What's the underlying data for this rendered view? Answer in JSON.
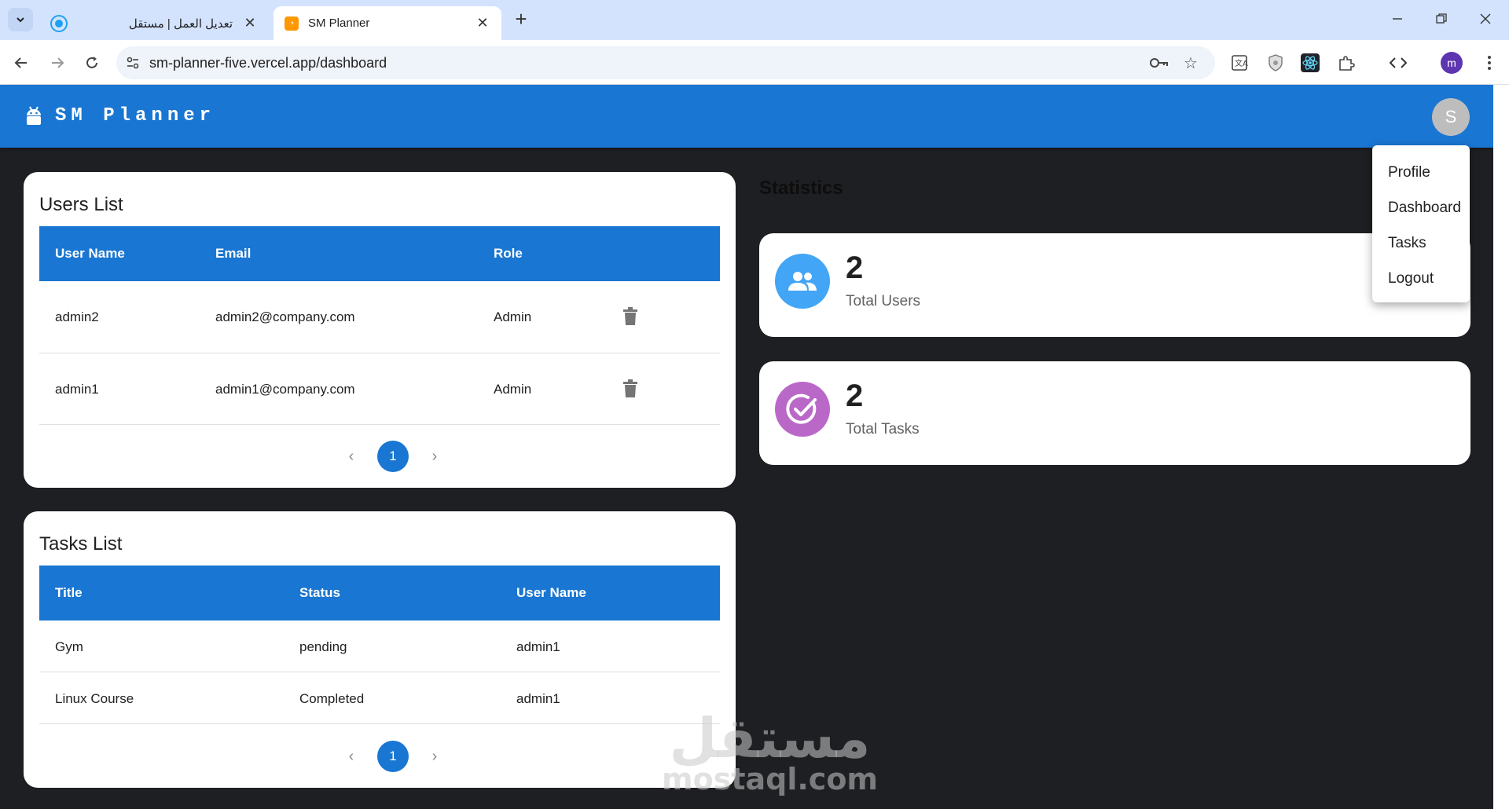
{
  "browser": {
    "tabs": [
      {
        "title": "تعديل العمل | مستقل",
        "active": false
      },
      {
        "title": "SM Planner",
        "active": true
      }
    ],
    "url_domain": "sm-planner-five.vercel.app",
    "url_path": "/dashboard",
    "profile_initial": "m"
  },
  "app": {
    "brand": "SM Planner",
    "avatar_initial": "S",
    "accent_color": "#1976d2"
  },
  "users_list": {
    "title": "Users List",
    "columns": [
      "User Name",
      "Email",
      "Role"
    ],
    "rows": [
      {
        "name": "admin2",
        "email": "admin2@company.com",
        "role": "Admin"
      },
      {
        "name": "admin1",
        "email": "admin1@company.com",
        "role": "Admin"
      }
    ],
    "page": "1"
  },
  "tasks_list": {
    "title": "Tasks List",
    "columns": [
      "Title",
      "Status",
      "User Name"
    ],
    "rows": [
      {
        "title": "Gym",
        "status": "pending",
        "user": "admin1"
      },
      {
        "title": "Linux Course",
        "status": "Completed",
        "user": "admin1"
      }
    ],
    "page": "1"
  },
  "statistics": {
    "heading": "Statistics",
    "cards": [
      {
        "value": "2",
        "label": "Total Users",
        "icon": "people-icon",
        "color": "#42a5f5"
      },
      {
        "value": "2",
        "label": "Total Tasks",
        "icon": "check-circle-icon",
        "color": "#ba68c8"
      }
    ]
  },
  "user_menu": {
    "items": [
      "Profile",
      "Dashboard",
      "Tasks",
      "Logout"
    ]
  },
  "watermark": {
    "arabic": "مستقل",
    "latin": "mostaql.com"
  }
}
